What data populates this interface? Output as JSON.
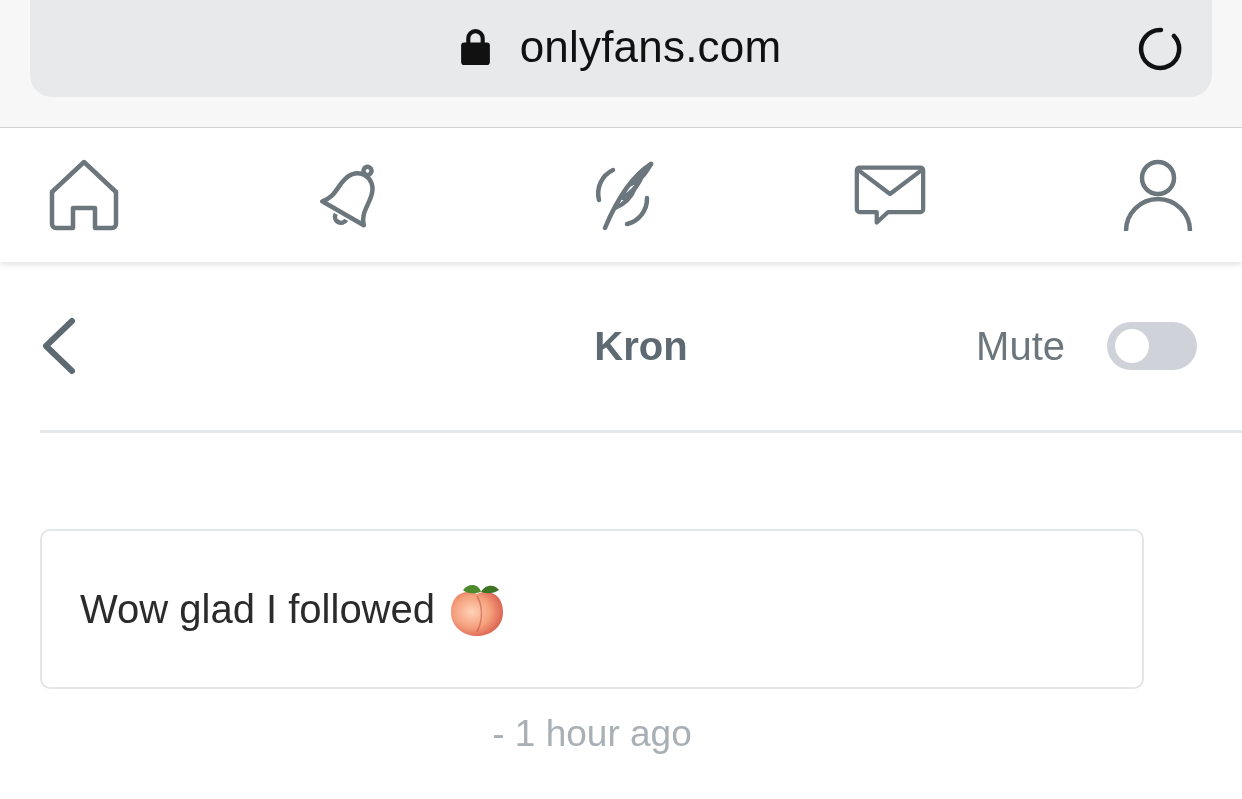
{
  "browser": {
    "url": "onlyfans.com",
    "secure": true
  },
  "header": {
    "title": "Kron",
    "mute": {
      "label": "Mute",
      "on": false
    }
  },
  "messages": [
    {
      "text": "Wow glad I followed",
      "time": "- 1 hour ago"
    }
  ]
}
